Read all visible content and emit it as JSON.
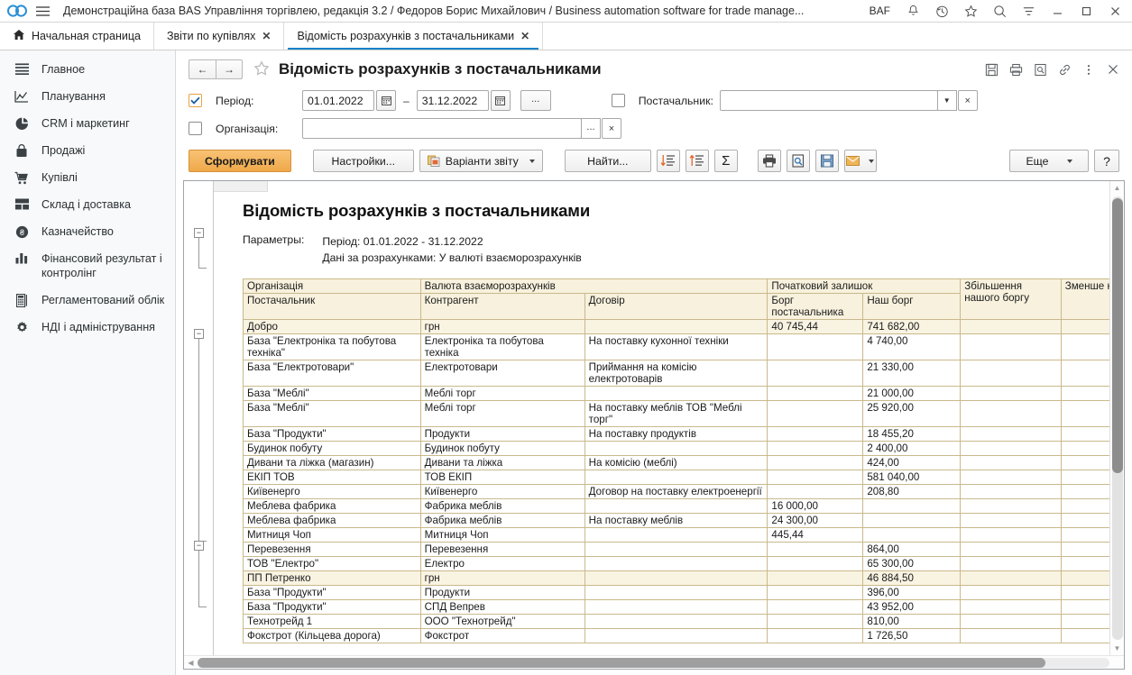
{
  "titlebar": {
    "logo_icon": "infinity-logo-icon",
    "menu_icon": "hamburger-menu-icon",
    "title": "Демонстраційна база BAS Управління торгівлею, редакція 3.2 / Федоров Борис Михайлович / Business automation software for trade manage...",
    "user_badge": "BAF",
    "icons": [
      "bell-icon",
      "history-icon",
      "star-icon",
      "search-icon",
      "filter-icon"
    ],
    "window_controls": [
      "minimize-icon",
      "maximize-icon",
      "close-icon"
    ]
  },
  "tabs": [
    {
      "label": "Начальная страница",
      "icon": "home-icon",
      "closable": false,
      "active": false
    },
    {
      "label": "Звіти по купівлях",
      "closable": true,
      "active": false
    },
    {
      "label": "Відомість розрахунків з постачальниками",
      "closable": true,
      "active": true
    }
  ],
  "tab_close_glyph": "✕",
  "sidebar": {
    "items": [
      {
        "label": "Главное",
        "icon": "list-icon"
      },
      {
        "label": "Планування",
        "icon": "chart-line-icon"
      },
      {
        "label": "CRM і маркетинг",
        "icon": "pie-chart-icon"
      },
      {
        "label": "Продажі",
        "icon": "bag-icon"
      },
      {
        "label": "Купівлі",
        "icon": "cart-icon"
      },
      {
        "label": "Склад і доставка",
        "icon": "grid-icon"
      },
      {
        "label": "Казначейство",
        "icon": "coin-icon"
      },
      {
        "label": "Фінансовий результат і контролінг",
        "icon": "bar-chart-icon"
      },
      {
        "label": "Регламентований облік",
        "icon": "calculator-icon"
      },
      {
        "label": "НДІ і адміністрування",
        "icon": "gear-icon"
      }
    ]
  },
  "form": {
    "back_glyph": "←",
    "forward_glyph": "→",
    "favorite_icon": "star-outline-icon",
    "title": "Відомість розрахунків з постачальниками",
    "header_icons": [
      "save-icon",
      "print-icon",
      "preview-icon",
      "link-icon",
      "more-icon",
      "close-icon"
    ]
  },
  "filters": {
    "period": {
      "checked": true,
      "label": "Періодʼ",
      "label_text": "Період:",
      "date_from": "01.01.2022",
      "date_to": "31.12.2022",
      "calendar_icon": "calendar-icon",
      "dash": "–",
      "more_button": "..."
    },
    "organization": {
      "checked": false,
      "label_text": "Організація:",
      "value": "",
      "select_button": "...",
      "clear_button": "×"
    },
    "supplier": {
      "checked": false,
      "label_text": "Постачальник:",
      "value": "",
      "dropdown_glyph": "▾",
      "clear_button": "×"
    }
  },
  "toolbar": {
    "generate": "Сформувати",
    "settings": "Настройки...",
    "variants": "Варіанти звіту",
    "variants_icon": "report-variants-icon",
    "find": "Найти...",
    "sort_desc_icon": "sort-descending-icon",
    "group_icon": "grouping-icon",
    "sum_icon": "sum-sigma-icon",
    "sum_glyph": "Σ",
    "print_icon": "print-icon",
    "preview_icon": "print-preview-icon",
    "save_icon": "save-floppy-icon",
    "mail_icon": "mail-icon",
    "more": "Еще",
    "help": "?"
  },
  "report": {
    "title": "Відомість розрахунків з постачальниками",
    "params_label": "Параметры:",
    "params_lines": [
      "Період: 01.01.2022 - 31.12.2022",
      "Дані за розрахунками: У валюті взаєморозрахунків"
    ],
    "header_row1": [
      "Організація",
      "Валюта взаєморозрахунків",
      "",
      "Початковий залишок",
      "",
      "Збільшення нашого боргу",
      "Зменше нашого"
    ],
    "header_row2": [
      "Постачальник",
      "Контрагент",
      "Договір",
      "Борг постачальника",
      "Наш борг",
      "",
      ""
    ],
    "rows": [
      {
        "type": "group",
        "c0": "Добро",
        "c1": "грн",
        "c2": "",
        "c3": "40 745,44",
        "c4": "741 682,00",
        "c5": "",
        "c6": ""
      },
      {
        "type": "item",
        "c0": "База \"Електроніка та побутова техніка\"",
        "c1": "Електроніка та побутова техніка",
        "c2": "На поставку кухонної техніки",
        "c3": "",
        "c4": "4 740,00",
        "c5": "",
        "c6": ""
      },
      {
        "type": "item",
        "c0": "База \"Електротовари\"",
        "c1": "Електротовари",
        "c2": "Приймання на комісію електротоварів",
        "c3": "",
        "c4": "21 330,00",
        "c5": "",
        "c6": ""
      },
      {
        "type": "item",
        "c0": "База \"Меблі\"",
        "c1": "Меблі торг",
        "c2": "",
        "c3": "",
        "c4": "21 000,00",
        "c5": "",
        "c6": ""
      },
      {
        "type": "item",
        "c0": "База \"Меблі\"",
        "c1": "Меблі торг",
        "c2": "На поставку меблів ТОВ \"Меблі торг\"",
        "c3": "",
        "c4": "25 920,00",
        "c5": "",
        "c6": ""
      },
      {
        "type": "item",
        "c0": "База \"Продукти\"",
        "c1": "Продукти",
        "c2": "На поставку продуктів",
        "c3": "",
        "c4": "18 455,20",
        "c5": "",
        "c6": ""
      },
      {
        "type": "item",
        "c0": "Будинок побуту",
        "c1": "Будинок побуту",
        "c2": "",
        "c3": "",
        "c4": "2 400,00",
        "c5": "",
        "c6": ""
      },
      {
        "type": "item",
        "c0": "Дивани та ліжка (магазин)",
        "c1": "Дивани та ліжка",
        "c2": "На комісію (меблі)",
        "c3": "",
        "c4": "424,00",
        "c5": "",
        "c6": ""
      },
      {
        "type": "item",
        "c0": "ЕКІП ТОВ",
        "c1": "ТОВ ЕКІП",
        "c2": "",
        "c3": "",
        "c4": "581 040,00",
        "c5": "",
        "c6": ""
      },
      {
        "type": "item",
        "c0": "Київенерго",
        "c1": "Київенерго",
        "c2": "Договор на поставку електроенергії",
        "c3": "",
        "c4": "208,80",
        "c5": "",
        "c6": ""
      },
      {
        "type": "item",
        "c0": "Меблева фабрика",
        "c1": "Фабрика меблів",
        "c2": "",
        "c3": "16 000,00",
        "c4": "",
        "c5": "",
        "c6": ""
      },
      {
        "type": "item",
        "c0": "Меблева фабрика",
        "c1": "Фабрика меблів",
        "c2": "На поставку меблів",
        "c3": "24 300,00",
        "c4": "",
        "c5": "",
        "c6": ""
      },
      {
        "type": "item",
        "c0": "Митниця Чоп",
        "c1": "Митниця Чоп",
        "c2": "",
        "c3": "445,44",
        "c4": "",
        "c5": "",
        "c6": ""
      },
      {
        "type": "item",
        "c0": "Перевезення",
        "c1": "Перевезення",
        "c2": "",
        "c3": "",
        "c4": "864,00",
        "c5": "",
        "c6": ""
      },
      {
        "type": "item",
        "c0": "ТОВ \"Електро\"",
        "c1": "Електро",
        "c2": "",
        "c3": "",
        "c4": "65 300,00",
        "c5": "",
        "c6": ""
      },
      {
        "type": "group",
        "c0": "ПП Петренко",
        "c1": "грн",
        "c2": "",
        "c3": "",
        "c4": "46 884,50",
        "c5": "",
        "c6": ""
      },
      {
        "type": "item",
        "c0": "База \"Продукти\"",
        "c1": "Продукти",
        "c2": "",
        "c3": "",
        "c4": "396,00",
        "c5": "",
        "c6": ""
      },
      {
        "type": "item",
        "c0": "База \"Продукти\"",
        "c1": "СПД Вепрев",
        "c2": "",
        "c3": "",
        "c4": "43 952,00",
        "c5": "",
        "c6": ""
      },
      {
        "type": "item",
        "c0": "Технотрейд 1",
        "c1": "ООО \"Технотрейд\"",
        "c2": "",
        "c3": "",
        "c4": "810,00",
        "c5": "",
        "c6": ""
      },
      {
        "type": "item",
        "c0": "Фокстрот (Кільцева дорога)",
        "c1": "Фокстрот",
        "c2": "",
        "c3": "",
        "c4": "1 726,50",
        "c5": "",
        "c6": ""
      }
    ],
    "collapse_glyph": "−"
  },
  "colors": {
    "accent_orange": "#efa84a",
    "tab_active_underline": "#1683c8",
    "table_border": "#c9b98b",
    "table_header_bg": "#f7f1dd",
    "group_row_bg": "#f9f3e2"
  }
}
